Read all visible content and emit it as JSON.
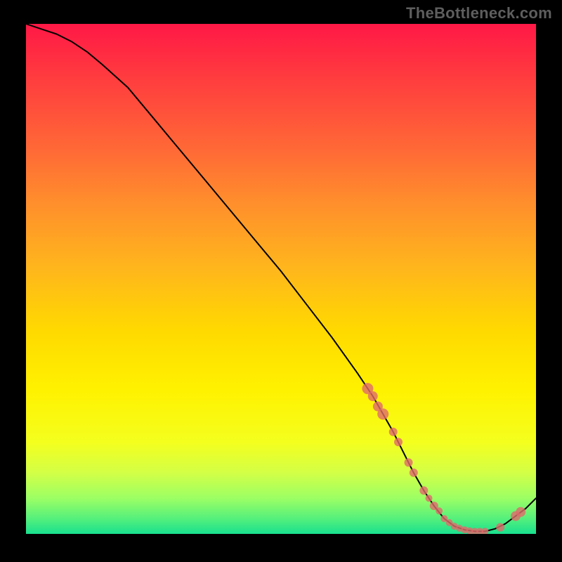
{
  "watermark": "TheBottleneck.com",
  "chart_data": {
    "type": "line",
    "title": "",
    "xlabel": "",
    "ylabel": "",
    "x_range": [
      0,
      100
    ],
    "y_range": [
      0,
      100
    ],
    "series": [
      {
        "name": "bottleneck-curve",
        "x": [
          0,
          3,
          6,
          9,
          12,
          15,
          20,
          25,
          30,
          35,
          40,
          45,
          50,
          55,
          60,
          65,
          68,
          70,
          72,
          74,
          76,
          78,
          80,
          82,
          84,
          86,
          88,
          90,
          92,
          94,
          96,
          98,
          100
        ],
        "y": [
          100,
          99,
          98,
          96.5,
          94.5,
          92,
          87.5,
          81.5,
          75.5,
          69.5,
          63.5,
          57.5,
          51.5,
          45,
          38.5,
          31.5,
          27,
          23.5,
          20,
          16,
          12,
          8.5,
          5.5,
          3,
          1.5,
          0.8,
          0.5,
          0.5,
          1,
          2,
          3.5,
          5,
          7
        ]
      }
    ],
    "marker_points": {
      "name": "scatter-markers",
      "x": [
        67,
        68,
        69,
        70,
        72,
        73,
        75,
        76,
        78,
        79,
        80,
        81,
        82,
        83,
        84,
        85,
        86,
        87,
        88,
        89,
        90,
        93,
        96,
        97
      ],
      "y": [
        28.5,
        27,
        25,
        23.5,
        20,
        18,
        14,
        12,
        8.5,
        7,
        5.5,
        4.5,
        3,
        2.2,
        1.5,
        1.1,
        0.8,
        0.6,
        0.5,
        0.5,
        0.5,
        1.3,
        3.5,
        4.3
      ],
      "r": [
        8,
        7,
        7,
        8,
        6,
        6,
        6,
        6,
        6,
        5,
        6,
        5,
        5,
        5,
        5,
        5,
        5,
        5,
        5,
        5,
        5,
        6,
        7,
        7
      ]
    },
    "colors": {
      "curve": "#000000",
      "marker": "#e06a6a",
      "gradient_top": "#ff1846",
      "gradient_bottom": "#18e08e"
    }
  }
}
